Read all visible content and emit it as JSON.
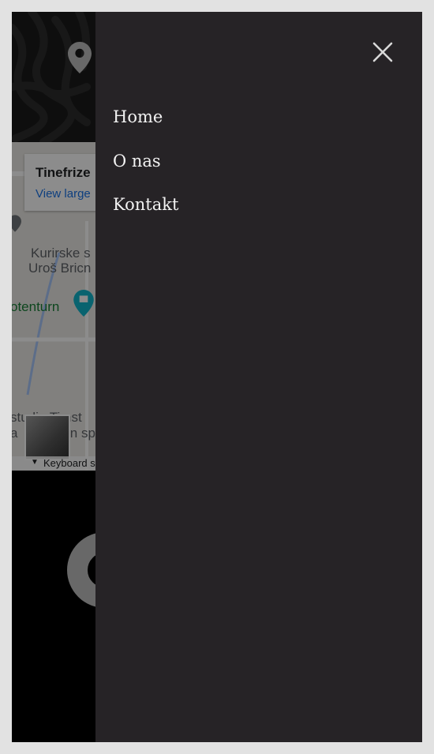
{
  "map": {
    "place_title": "Tinefrize",
    "view_larger": "View large",
    "labels": {
      "street_1": "Kurirske s",
      "street_2": "Uroš Bricn",
      "poi": "otenturn",
      "studio": "studio Timst",
      "studio_2": "a",
      "studio_3": "in sp"
    },
    "footer": "Keyboard s"
  },
  "menu": {
    "items": [
      {
        "label": "Home"
      },
      {
        "label": "O nas"
      },
      {
        "label": "Kontakt"
      }
    ],
    "close_icon": "close-icon"
  },
  "colors": {
    "menu_bg": "#262326",
    "menu_text": "#f2f2f2",
    "page_bg": "#e2e2e2",
    "pin": "#bdbdbd"
  }
}
